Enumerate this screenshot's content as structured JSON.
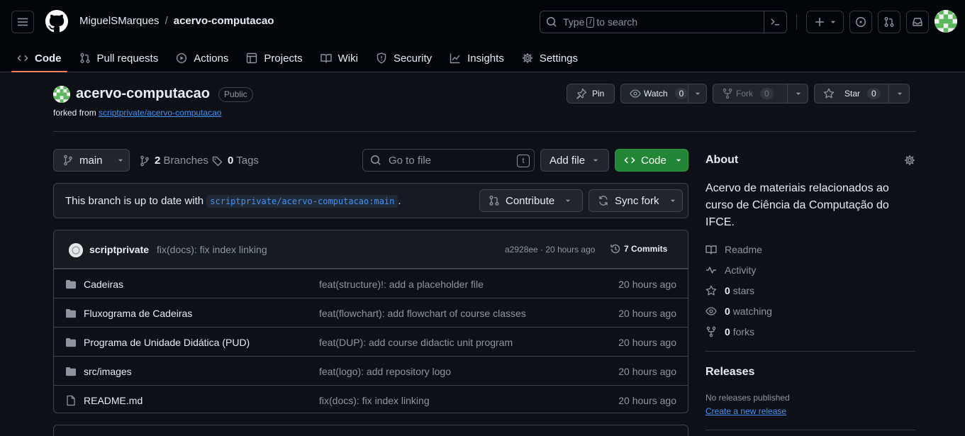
{
  "header": {
    "owner": "MiguelSMarques",
    "separator": "/",
    "repo": "acervo-computacao",
    "search": {
      "prefix": "Type",
      "key": "/",
      "suffix": "to search"
    }
  },
  "nav": {
    "tabs": [
      {
        "label": "Code",
        "icon": "code-icon",
        "active": true
      },
      {
        "label": "Pull requests",
        "icon": "git-pull-request-icon"
      },
      {
        "label": "Actions",
        "icon": "play-icon"
      },
      {
        "label": "Projects",
        "icon": "table-icon"
      },
      {
        "label": "Wiki",
        "icon": "book-icon"
      },
      {
        "label": "Security",
        "icon": "shield-icon"
      },
      {
        "label": "Insights",
        "icon": "graph-icon"
      },
      {
        "label": "Settings",
        "icon": "gear-icon"
      }
    ]
  },
  "repo": {
    "name": "acervo-computacao",
    "visibility": "Public",
    "forked_prefix": "forked from",
    "forked_source": "scriptprivate/acervo-computacao",
    "pin_label": "Pin",
    "watch_label": "Watch",
    "watch_count": "0",
    "fork_label": "Fork",
    "fork_count": "0",
    "star_label": "Star",
    "star_count": "0"
  },
  "file_nav": {
    "branch": "main",
    "branches_count": "2",
    "branches_label": "Branches",
    "tags_count": "0",
    "tags_label": "Tags",
    "goto_placeholder": "Go to file",
    "goto_key": "t",
    "add_file_label": "Add file",
    "code_label": "Code"
  },
  "branch_status": {
    "text_prefix": "This branch is up to date with",
    "ref": "scriptprivate/acervo-computacao:main",
    "text_suffix": ".",
    "contribute_label": "Contribute",
    "sync_label": "Sync fork"
  },
  "latest_commit": {
    "author": "scriptprivate",
    "message": "fix(docs): fix index linking",
    "meta": "a2928ee · 20 hours ago",
    "commits_label": "7 Commits"
  },
  "files": [
    {
      "name": "Cadeiras",
      "type": "folder",
      "message": "feat(structure)!: add a placeholder file",
      "age": "20 hours ago"
    },
    {
      "name": "Fluxograma de Cadeiras",
      "type": "folder",
      "message": "feat(flowchart): add flowchart of course classes",
      "age": "20 hours ago"
    },
    {
      "name": "Programa de Unidade Didática (PUD)",
      "type": "folder",
      "message": "feat(DUP): add course didactic unit program",
      "age": "20 hours ago"
    },
    {
      "name": "src/images",
      "type": "folder",
      "message": "feat(logo): add repository logo",
      "age": "20 hours ago"
    },
    {
      "name": "README.md",
      "type": "file",
      "message": "fix(docs): fix index linking",
      "age": "20 hours ago"
    }
  ],
  "about": {
    "heading": "About",
    "description": "Acervo de materiais relacionados ao curso de Ciência da Computação do IFCE.",
    "readme_label": "Readme",
    "activity_label": "Activity",
    "stars_count": "0",
    "stars_label": "stars",
    "watching_count": "0",
    "watching_label": "watching",
    "forks_count": "0",
    "forks_label": "forks"
  },
  "releases": {
    "heading": "Releases",
    "empty_text": "No releases published",
    "create_link": "Create a new release"
  },
  "colors": {
    "background": "#0d1117",
    "header_background": "#010409",
    "accent_green": "#238636",
    "link_blue": "#4493f8",
    "active_tab_underline": "#f78166"
  }
}
